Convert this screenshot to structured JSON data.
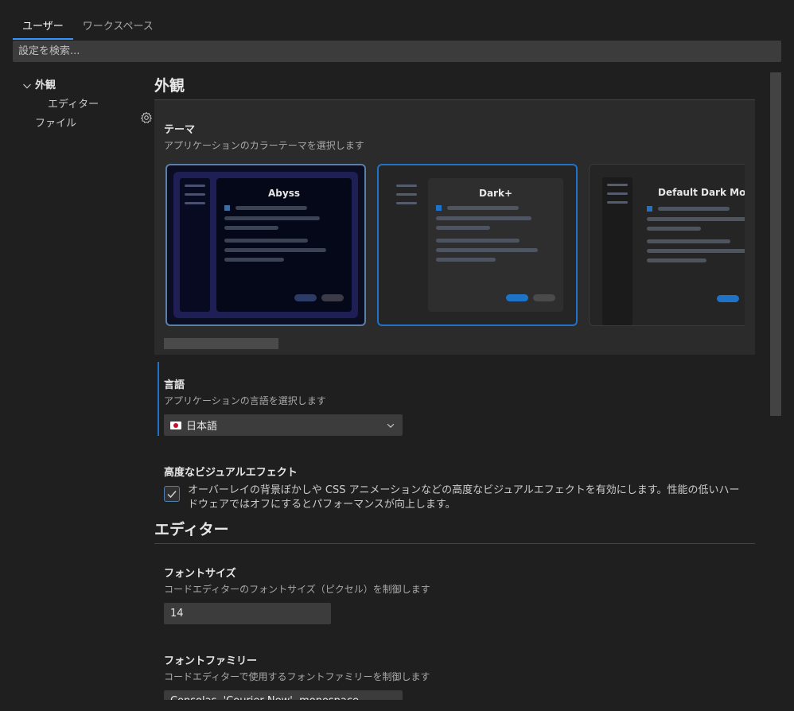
{
  "tabs": [
    "ユーザー",
    "ワークスペース"
  ],
  "search": {
    "placeholder": "設定を検索..."
  },
  "tree": {
    "appearance": "外観",
    "editor": "エディター",
    "file": "ファイル"
  },
  "sections": {
    "appearance": "外観",
    "editor": "エディター"
  },
  "theme": {
    "title": "テーマ",
    "description": "アプリケーションのカラーテーマを選択します",
    "cards": [
      "Abyss",
      "Dark+",
      "Default Dark Modern"
    ],
    "selected": "Dark+"
  },
  "language": {
    "title": "言語",
    "description": "アプリケーションの言語を選択します",
    "value": "日本語"
  },
  "visual_effects": {
    "title": "高度なビジュアルエフェクト",
    "description_line1": "オーバーレイの背景ぼかしや CSS アニメーションなどの高度なビジュアルエフェクトを有効にします。性能の低いハー",
    "description_line2": "ドウェアではオフにするとパフォーマンスが向上します。",
    "checked": true
  },
  "font_size": {
    "title": "フォントサイズ",
    "description": "コードエディターのフォントサイズ（ピクセル）を制御します",
    "value": "14"
  },
  "font_family": {
    "title": "フォントファミリー",
    "description": "コードエディターで使用するフォントファミリーを制御します",
    "value": "Consolas, 'Courier New', monospace"
  },
  "colors": {
    "accent": "#1e73c8",
    "background": "#1f1f1f"
  }
}
